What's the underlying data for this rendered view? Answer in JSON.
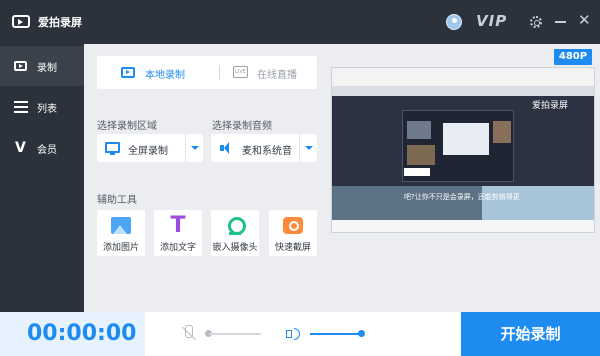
{
  "window": {
    "title": "爱拍录屏",
    "vip_label": "VIP",
    "close_glyph": "✕"
  },
  "sidebar": {
    "items": [
      {
        "label": "录制",
        "icon": "record-icon",
        "active": true
      },
      {
        "label": "列表",
        "icon": "list-icon",
        "active": false
      },
      {
        "label": "会员",
        "icon": "vip-icon",
        "icon_glyph": "V",
        "active": false
      }
    ]
  },
  "mode": {
    "local_label": "本地录制",
    "live_label": "在线直播",
    "live_icon_text": "LIVE"
  },
  "record_area": {
    "section_label": "选择录制区域",
    "selected": "全屏录制"
  },
  "record_audio": {
    "section_label": "选择录制音频",
    "selected": "麦和系统音"
  },
  "tools": {
    "section_label": "辅助工具",
    "items": [
      {
        "label": "添加图片",
        "icon": "image-icon"
      },
      {
        "label": "添加文字",
        "icon": "text-icon",
        "glyph": "T"
      },
      {
        "label": "嵌入摄像头",
        "icon": "camera-icon"
      },
      {
        "label": "快速截屏",
        "icon": "screenshot-icon"
      }
    ]
  },
  "preview": {
    "resolution": "480P",
    "watermark": "爱拍录屏",
    "caption": "吧?让你不只是会录屏，还能剪辑得更"
  },
  "bottom": {
    "timer": "00:00:00",
    "mic_level": 0,
    "speaker_level": 1.0,
    "start_label": "开始录制"
  },
  "colors": {
    "accent": "#1e8bf0",
    "sidebar_bg": "#2b323c",
    "main_bg": "#ebedf0"
  }
}
